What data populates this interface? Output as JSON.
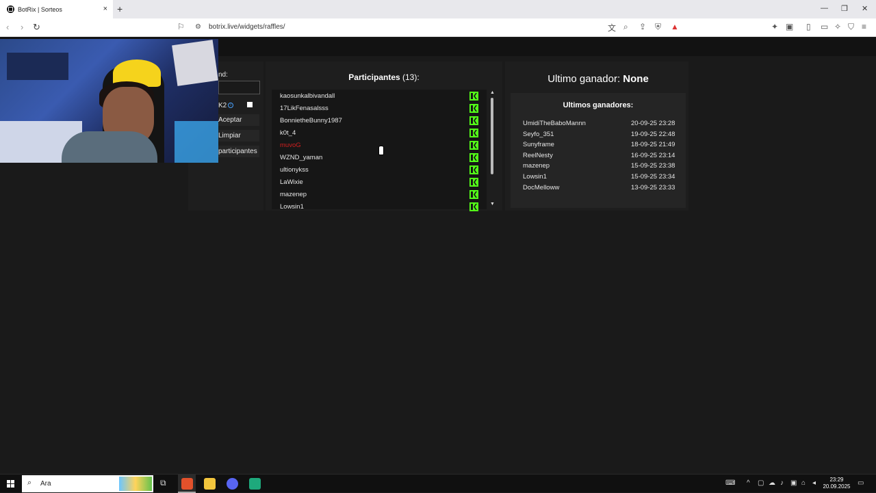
{
  "browser": {
    "tab_title": "BotRix | Sorteos",
    "tab_close": "×",
    "new_tab": "+",
    "url": "botrix.live/widgets/raffles/",
    "window": {
      "minimize": "—",
      "restore": "❐",
      "close": "✕"
    }
  },
  "controls": {
    "field_label": "nd:",
    "option_label": "K2",
    "accept_label": "Aceptar",
    "clear_label": "Limpiar",
    "participants_label": "participantes"
  },
  "participants": {
    "title": "Participantes",
    "count": "(13):",
    "items": [
      {
        "name": "kaosunkalbivandall",
        "excluded": false
      },
      {
        "name": "17LikFenasalsss",
        "excluded": false
      },
      {
        "name": "BonnietheBunny1987",
        "excluded": false
      },
      {
        "name": "k0t_4",
        "excluded": false
      },
      {
        "name": "muvoG",
        "excluded": true
      },
      {
        "name": "WZND_yaman",
        "excluded": false
      },
      {
        "name": "ultionykss",
        "excluded": false
      },
      {
        "name": "LaWixie",
        "excluded": false
      },
      {
        "name": "mazenep",
        "excluded": false
      },
      {
        "name": "Lowsin1",
        "excluded": false
      }
    ],
    "platform_icon": "kick-icon",
    "platform_color": "#53fc18"
  },
  "winners": {
    "last_label": "Ultimo ganador:",
    "last_value": "None",
    "list_title": "Ultimos ganadores:",
    "items": [
      {
        "name": "UmidiTheBaboMannn",
        "date": "20-09-25 23:28"
      },
      {
        "name": "Seyfo_351",
        "date": "19-09-25 22:48"
      },
      {
        "name": "Sunyframe",
        "date": "18-09-25 21:49"
      },
      {
        "name": "ReelNesty",
        "date": "16-09-25 23:14"
      },
      {
        "name": "mazenep",
        "date": "15-09-25 23:38"
      },
      {
        "name": "Lowsin1",
        "date": "15-09-25 23:34"
      },
      {
        "name": "DocMelloww",
        "date": "13-09-25 23:33"
      }
    ]
  },
  "taskbar": {
    "search_text": "Ara",
    "time": "23:29",
    "date": "20.09.2025"
  }
}
